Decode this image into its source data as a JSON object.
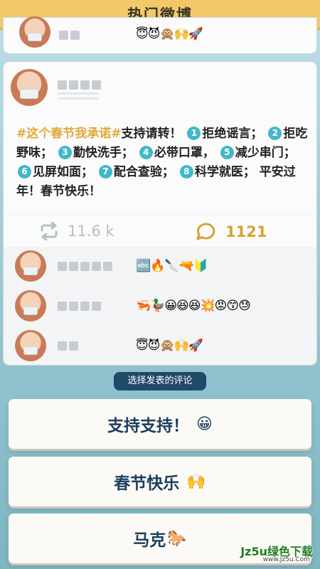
{
  "header": {
    "title": "热门微博"
  },
  "top_comment": {
    "emojis": "😇😈🙊🙌🚀"
  },
  "post": {
    "hashtag": "#这个春节我承诺#",
    "text_intro": "支持请转！",
    "items": [
      {
        "n": "1",
        "text": "拒绝谣言；"
      },
      {
        "n": "2",
        "text": "拒吃野味；"
      },
      {
        "n": "3",
        "text": "勤快洗手；"
      },
      {
        "n": "4",
        "text": "必带口罩，"
      },
      {
        "n": "5",
        "text": "减少串门；"
      },
      {
        "n": "6",
        "text": "见屏如面；"
      },
      {
        "n": "7",
        "text": "配合查验；"
      },
      {
        "n": "8",
        "text": "科学就医；"
      }
    ],
    "closing": "平安过年！春节快乐！",
    "reposts": "11.6 k",
    "comments_count": "1121"
  },
  "comments": [
    {
      "emojis": "🔤🔥🔪🔫🔰"
    },
    {
      "emojis": "🦐🦆😀😆😆💥😡😙😓"
    },
    {
      "emojis": "😇😈🙊🙌🚀"
    }
  ],
  "picker": {
    "label": "选择发表的评论"
  },
  "choices": [
    {
      "label": "支持支持！",
      "emoji": "😀"
    },
    {
      "label": "春节快乐",
      "emoji": "🙌"
    },
    {
      "label": "马克",
      "emoji": "🐎"
    }
  ],
  "watermark": {
    "text": "Jz5u绿色下载",
    "url": "www.Jz5u.Com"
  }
}
